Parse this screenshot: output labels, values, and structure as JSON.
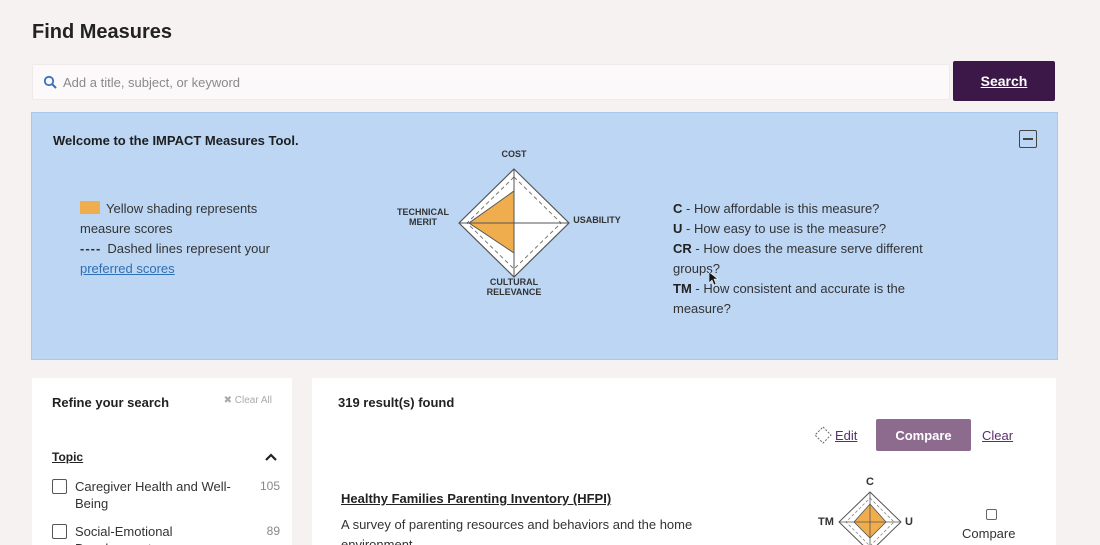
{
  "page": {
    "title": "Find Measures"
  },
  "search": {
    "placeholder": "Add a title, subject, or keyword",
    "button_label": "Search"
  },
  "welcome": {
    "title": "Welcome to the IMPACT Measures Tool.",
    "legend": {
      "yellow_text": "Yellow shading represents measure scores",
      "dash_sample": "----",
      "dashed_text": "Dashed lines represent your",
      "link_text": "preferred scores"
    },
    "radar": {
      "top": "COST",
      "right": "USABILITY",
      "bottom_line1": "CULTURAL",
      "bottom_line2": "RELEVANCE",
      "left_line1": "TECHNICAL",
      "left_line2": "MERIT"
    },
    "definitions": [
      {
        "abbr": "C",
        "text": " - How affordable is this measure?"
      },
      {
        "abbr": "U",
        "text": " - How easy to use is the measure?"
      },
      {
        "abbr": "CR",
        "text": " - How does the measure serve different groups?"
      },
      {
        "abbr": "TM",
        "text": " - How consistent and accurate is the measure?"
      }
    ],
    "colors": {
      "panel": "#bcd6f4",
      "shading": "#f0ad4e"
    }
  },
  "refine": {
    "title": "Refine your search",
    "clear_all": "Clear All",
    "topic_label": "Topic",
    "items": [
      {
        "label": "Caregiver Health and Well-Being",
        "count": "105"
      },
      {
        "label": "Social-Emotional Development",
        "count": "89"
      }
    ]
  },
  "results": {
    "count_text": "319 result(s) found",
    "edit_label": "Edit",
    "compare_label": "Compare",
    "clear_label": "Clear",
    "items": [
      {
        "title": "Healthy Families Parenting Inventory (HFPI)",
        "description": "A survey of parenting resources and behaviors and the home environment",
        "radar": {
          "top": "C",
          "right": "U",
          "left": "TM"
        },
        "compare_label": "Compare"
      }
    ]
  },
  "colors": {
    "brand": "#3b1847",
    "compare_button": "#8c6b8f",
    "link": "#5a2e6e"
  }
}
